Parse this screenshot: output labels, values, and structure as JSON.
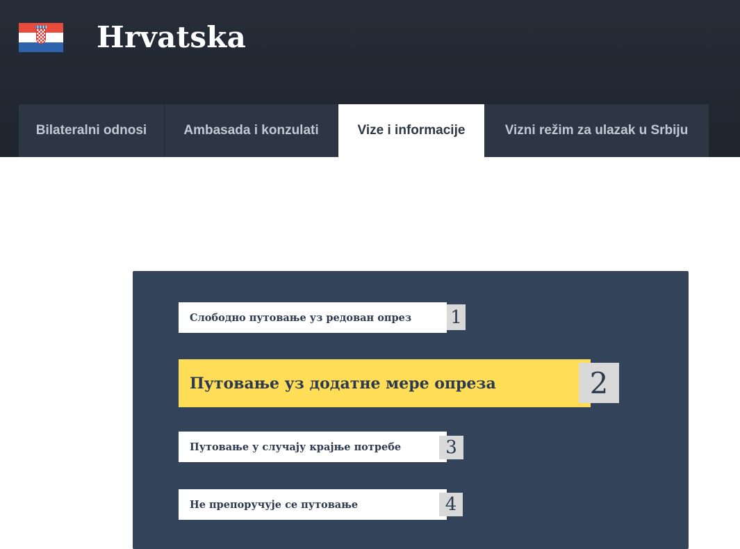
{
  "header": {
    "title": "Hrvatska",
    "flag_icon": "croatia-flag-icon"
  },
  "tabs": [
    {
      "label": "Bilateralni odnosi",
      "active": false
    },
    {
      "label": "Ambasada i konzulati",
      "active": false
    },
    {
      "label": "Vize i informacije",
      "active": true
    },
    {
      "label": "Vizni režim za ulazak u Srbiju",
      "active": false
    }
  ],
  "travel_levels": [
    {
      "number": "1",
      "label": "Слободно путовање уз редован опрез",
      "highlighted": false
    },
    {
      "number": "2",
      "label": "Путовање уз додатне мере опреза",
      "highlighted": true
    },
    {
      "number": "3",
      "label": "Путовање у случају крајње потребе",
      "highlighted": false
    },
    {
      "number": "4",
      "label": "Не препоручује се путовање",
      "highlighted": false
    }
  ],
  "colors": {
    "header_bg": "#1e252f",
    "tab_bg": "#2d3744",
    "panel_bg": "#33435a",
    "highlight": "#ffdd57"
  }
}
